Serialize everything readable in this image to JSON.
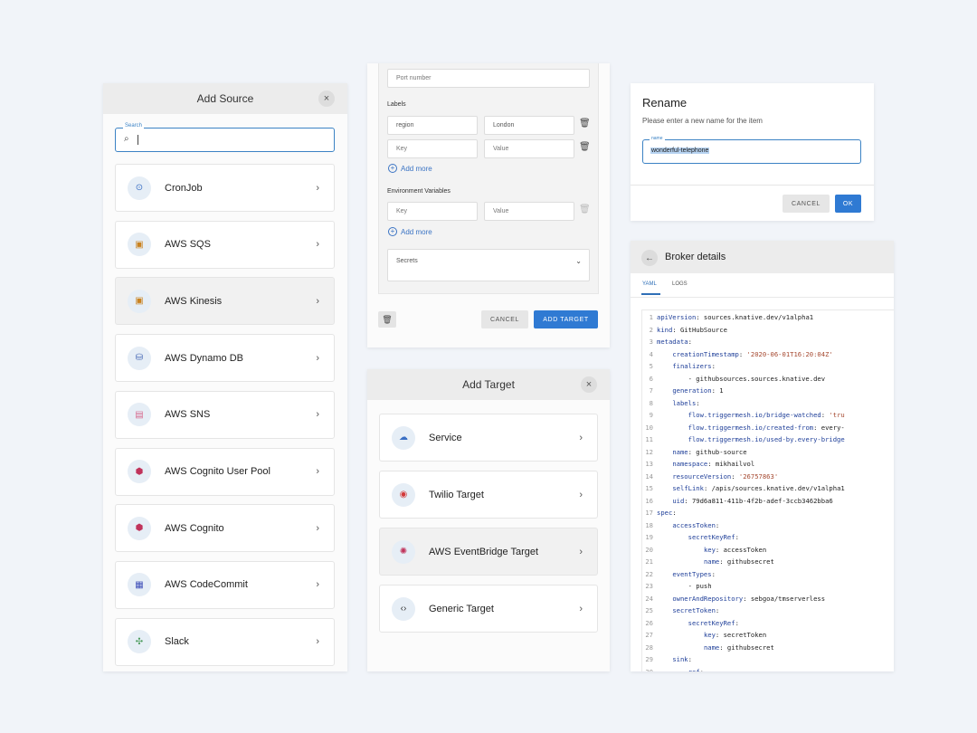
{
  "add_source": {
    "title": "Add Source",
    "close_icon": "×",
    "search_label": "Search",
    "search_icon": "⌕",
    "selected_index": 2,
    "items": [
      {
        "label": "CronJob",
        "icon": "cronjob-icon",
        "glyph": "⊙",
        "color": "#3a6fc4"
      },
      {
        "label": "AWS SQS",
        "icon": "aws-sqs-icon",
        "glyph": "▣",
        "color": "#c9821f"
      },
      {
        "label": "AWS Kinesis",
        "icon": "aws-kinesis-icon",
        "glyph": "▣",
        "color": "#c9821f"
      },
      {
        "label": "AWS Dynamo DB",
        "icon": "aws-dynamodb-icon",
        "glyph": "⛁",
        "color": "#3b5fb0"
      },
      {
        "label": "AWS SNS",
        "icon": "aws-sns-icon",
        "glyph": "▤",
        "color": "#d76b8e"
      },
      {
        "label": "AWS Cognito User Pool",
        "icon": "aws-cognito-user-pool-icon",
        "glyph": "⬢",
        "color": "#c0335b"
      },
      {
        "label": "AWS Cognito",
        "icon": "aws-cognito-icon",
        "glyph": "⬢",
        "color": "#c0335b"
      },
      {
        "label": "AWS CodeCommit",
        "icon": "aws-codecommit-icon",
        "glyph": "▦",
        "color": "#3f4fb8"
      },
      {
        "label": "Slack",
        "icon": "slack-icon",
        "glyph": "✣",
        "color": "#4a9b5b"
      }
    ],
    "chevron": "›"
  },
  "form": {
    "port_placeholder": "Port number",
    "labels_heading": "Labels",
    "label_rows": [
      {
        "key": "region",
        "value": "London"
      },
      {
        "key": "Key",
        "value": "Value"
      }
    ],
    "add_more": "Add more",
    "env_heading": "Environment Variables",
    "env_rows": [
      {
        "key": "Key",
        "value": "Value"
      }
    ],
    "secrets_label": "Secrets",
    "cancel": "CANCEL",
    "add_target": "ADD TARGET",
    "trash_icon": "🗑",
    "dropdown_icon": "⌄",
    "plus_icon": "+"
  },
  "add_target": {
    "title": "Add Target",
    "close_icon": "×",
    "selected_index": 2,
    "items": [
      {
        "label": "Service",
        "icon": "service-cloud-icon",
        "glyph": "☁",
        "color": "#3a6fc4"
      },
      {
        "label": "Twilio Target",
        "icon": "twilio-icon",
        "glyph": "◉",
        "color": "#d33a3a"
      },
      {
        "label": "AWS EventBridge Target",
        "icon": "aws-eventbridge-icon",
        "glyph": "✺",
        "color": "#c0335b"
      },
      {
        "label": "Generic Target",
        "icon": "code-brackets-icon",
        "glyph": "‹›",
        "color": "#333333"
      }
    ],
    "chevron": "›"
  },
  "rename": {
    "title": "Rename",
    "subtitle": "Please enter a new name for the item",
    "field_label": "name",
    "value": "wonderful-telephone",
    "cancel": "CANCEL",
    "ok": "OK"
  },
  "broker": {
    "title": "Broker details",
    "back_icon": "←",
    "tabs": [
      "YAML",
      "LOGS"
    ],
    "lines": [
      [
        [
          "k",
          "apiVersion"
        ],
        [
          "p",
          ": sources.knative.dev/v1alpha1"
        ]
      ],
      [
        [
          "k",
          "kind"
        ],
        [
          "p",
          ": GitHubSource"
        ]
      ],
      [
        [
          "k",
          "metadata"
        ],
        [
          "p",
          ":"
        ]
      ],
      [
        [
          "p",
          "    "
        ],
        [
          "k",
          "creationTimestamp"
        ],
        [
          "p",
          ": "
        ],
        [
          "s",
          "'2020-06-01T16:20:04Z'"
        ]
      ],
      [
        [
          "p",
          "    "
        ],
        [
          "k",
          "finalizers"
        ],
        [
          "p",
          ":"
        ]
      ],
      [
        [
          "p",
          "        - githubsources.sources.knative.dev"
        ]
      ],
      [
        [
          "p",
          "    "
        ],
        [
          "k",
          "generation"
        ],
        [
          "p",
          ": 1"
        ]
      ],
      [
        [
          "p",
          "    "
        ],
        [
          "k",
          "labels"
        ],
        [
          "p",
          ":"
        ]
      ],
      [
        [
          "p",
          "        "
        ],
        [
          "k",
          "flow.triggermesh.io/bridge-watched"
        ],
        [
          "p",
          ": "
        ],
        [
          "s",
          "'tru"
        ]
      ],
      [
        [
          "p",
          "        "
        ],
        [
          "k",
          "flow.triggermesh.io/created-from"
        ],
        [
          "p",
          ": every-"
        ]
      ],
      [
        [
          "p",
          "        "
        ],
        [
          "k",
          "flow.triggermesh.io/used-by.every-bridge"
        ]
      ],
      [
        [
          "p",
          "    "
        ],
        [
          "k",
          "name"
        ],
        [
          "p",
          ": github-source"
        ]
      ],
      [
        [
          "p",
          "    "
        ],
        [
          "k",
          "namespace"
        ],
        [
          "p",
          ": mikhailvol"
        ]
      ],
      [
        [
          "p",
          "    "
        ],
        [
          "k",
          "resourceVersion"
        ],
        [
          "p",
          ": "
        ],
        [
          "s",
          "'26757863'"
        ]
      ],
      [
        [
          "p",
          "    "
        ],
        [
          "k",
          "selfLink"
        ],
        [
          "p",
          ": /apis/sources.knative.dev/v1alpha1"
        ]
      ],
      [
        [
          "p",
          "    "
        ],
        [
          "k",
          "uid"
        ],
        [
          "p",
          ": 79d6a811-411b-4f2b-adef-3ccb3462bba6"
        ]
      ],
      [
        [
          "k",
          "spec"
        ],
        [
          "p",
          ":"
        ]
      ],
      [
        [
          "p",
          "    "
        ],
        [
          "k",
          "accessToken"
        ],
        [
          "p",
          ":"
        ]
      ],
      [
        [
          "p",
          "        "
        ],
        [
          "k",
          "secretKeyRef"
        ],
        [
          "p",
          ":"
        ]
      ],
      [
        [
          "p",
          "            "
        ],
        [
          "k",
          "key"
        ],
        [
          "p",
          ": accessToken"
        ]
      ],
      [
        [
          "p",
          "            "
        ],
        [
          "k",
          "name"
        ],
        [
          "p",
          ": githubsecret"
        ]
      ],
      [
        [
          "p",
          "    "
        ],
        [
          "k",
          "eventTypes"
        ],
        [
          "p",
          ":"
        ]
      ],
      [
        [
          "p",
          "        - push"
        ]
      ],
      [
        [
          "p",
          "    "
        ],
        [
          "k",
          "ownerAndRepository"
        ],
        [
          "p",
          ": sebgoa/tmserverless"
        ]
      ],
      [
        [
          "p",
          "    "
        ],
        [
          "k",
          "secretToken"
        ],
        [
          "p",
          ":"
        ]
      ],
      [
        [
          "p",
          "        "
        ],
        [
          "k",
          "secretKeyRef"
        ],
        [
          "p",
          ":"
        ]
      ],
      [
        [
          "p",
          "            "
        ],
        [
          "k",
          "key"
        ],
        [
          "p",
          ": secretToken"
        ]
      ],
      [
        [
          "p",
          "            "
        ],
        [
          "k",
          "name"
        ],
        [
          "p",
          ": githubsecret"
        ]
      ],
      [
        [
          "p",
          "    "
        ],
        [
          "k",
          "sink"
        ],
        [
          "p",
          ":"
        ]
      ],
      [
        [
          "p",
          "        "
        ],
        [
          "k",
          "ref"
        ],
        [
          "p",
          ":"
        ]
      ]
    ]
  }
}
